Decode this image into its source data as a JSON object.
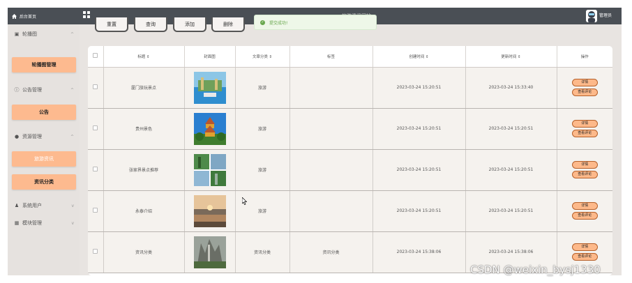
{
  "topbar": {
    "home_label": "后台首页",
    "site_title": "旅游资讯网站",
    "admin_label": "管理员"
  },
  "toast": {
    "message": "提交成功!"
  },
  "sidebar": {
    "menus": [
      {
        "label": "轮播图",
        "icon": "image-icon"
      },
      {
        "label": "公告管理",
        "icon": "info-icon"
      },
      {
        "label": "资源管理",
        "icon": "location-icon"
      },
      {
        "label": "系统用户",
        "icon": "user-icon"
      },
      {
        "label": "模块管理",
        "icon": "grid-icon"
      }
    ],
    "subs": [
      "轮播图管理",
      "公告",
      "旅游资讯",
      "资讯分类"
    ]
  },
  "actions": [
    "重置",
    "查询",
    "添加",
    "删除"
  ],
  "table": {
    "headers": [
      "",
      "标题 ⇕",
      "封面图",
      "文章分类 ⇕",
      "标签",
      "创建时间 ⇕",
      "更新时间 ⇕",
      "操作"
    ],
    "rows": [
      {
        "title": "厦门旅玩景点",
        "category": "旅游",
        "tag": "",
        "created": "2023-03-24 15:20:51",
        "updated": "2023-03-24 15:33:40"
      },
      {
        "title": "贵州景色",
        "category": "旅游",
        "tag": "",
        "created": "2023-03-24 15:20:51",
        "updated": "2023-03-24 15:20:51"
      },
      {
        "title": "张家界景点推荐",
        "category": "旅游",
        "tag": "",
        "created": "2023-03-24 15:20:51",
        "updated": "2023-03-24 15:20:51"
      },
      {
        "title": "永泰介绍",
        "category": "旅游",
        "tag": "",
        "created": "2023-03-24 15:20:51",
        "updated": "2023-03-24 15:20:51"
      },
      {
        "title": "资讯分类",
        "category": "资讯分类",
        "tag": "资讯分类",
        "created": "2023-03-24 15:38:06",
        "updated": "2023-03-24 15:38:06"
      }
    ],
    "op_detail": "详情",
    "op_comment": "查看评论"
  },
  "watermark": "CSDN @weixin_bysj1330",
  "colors": {
    "topbar": "#4a4f55",
    "accent": "#fdba8f",
    "toast_text": "#6aa84f"
  }
}
